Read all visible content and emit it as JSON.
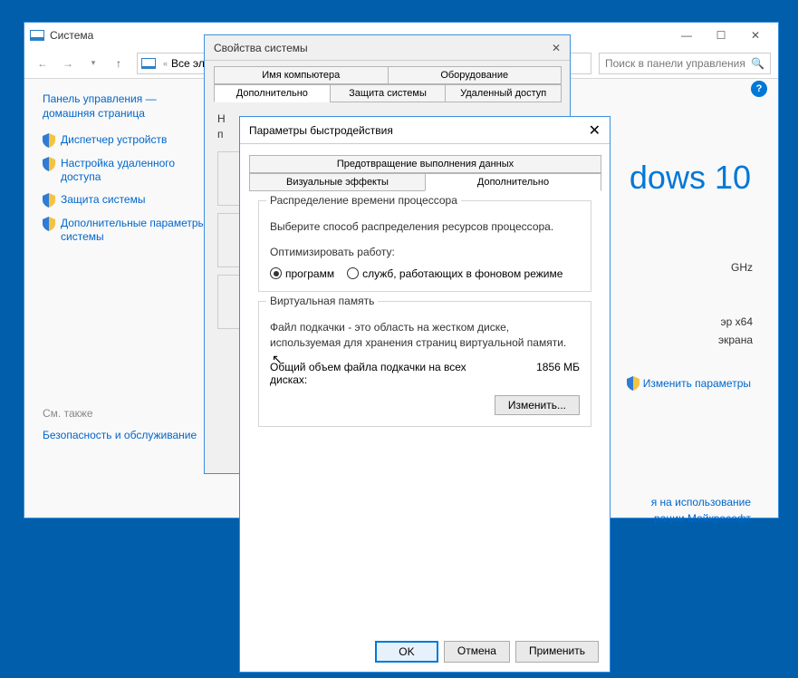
{
  "main_window": {
    "title": "Система",
    "breadcrumb": "Все элем",
    "search_placeholder": "Поиск в панели управления",
    "leftnav": {
      "home": "Панель управления —\nдомашняя страница",
      "items": [
        "Диспетчер устройств",
        "Настройка удаленного доступа",
        "Защита системы",
        "Дополнительные параметры системы"
      ],
      "see_also": "См. также",
      "security": "Безопасность и обслуживание"
    },
    "right": {
      "ghz": "GHz",
      "arch": "эр x64",
      "screen": "экрана",
      "logo": "dows 10",
      "change_params": "Изменить параметры",
      "terms1": "я на использование",
      "terms2": "рации Майкрософт"
    }
  },
  "sys_props": {
    "title": "Свойства системы",
    "tabs_top": [
      "Имя компьютера",
      "Оборудование"
    ],
    "tabs_bot": [
      "Дополнительно",
      "Защита системы",
      "Удаленный доступ"
    ],
    "partial1": "Н",
    "partial2": "п"
  },
  "perf": {
    "title": "Параметры быстродействия",
    "tab_top": "Предотвращение выполнения данных",
    "tabs_bot": [
      "Визуальные эффекты",
      "Дополнительно"
    ],
    "cpu": {
      "legend": "Распределение времени процессора",
      "desc": "Выберите способ распределения ресурсов процессора.",
      "optimize": "Оптимизировать работу:",
      "r1": "программ",
      "r2": "служб, работающих в фоновом режиме"
    },
    "vm": {
      "legend": "Виртуальная память",
      "desc": "Файл подкачки - это область на жестком диске, используемая для хранения страниц виртуальной памяти.",
      "total_label": "Общий объем файла подкачки на всех дисках:",
      "total_value": "1856 МБ",
      "change": "Изменить..."
    },
    "buttons": {
      "ok": "OK",
      "cancel": "Отмена",
      "apply": "Применить"
    }
  }
}
